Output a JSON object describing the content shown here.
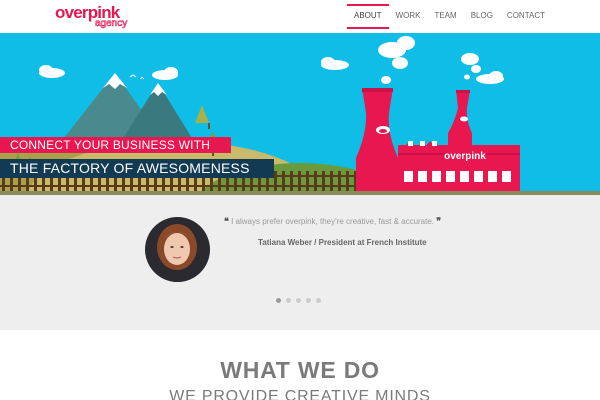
{
  "brand": {
    "name": "overpink",
    "tagline": "agency",
    "color": "#e8174f"
  },
  "nav": {
    "items": [
      "ABOUT",
      "WORK",
      "TEAM",
      "BLOG",
      "CONTACT"
    ],
    "active": "ABOUT"
  },
  "hero": {
    "line1": "CONNECT YOUR BUSINESS WITH",
    "line2": "THE FACTORY OF AWESOMENESS",
    "factory_sign": "overpink",
    "sky_color": "#10bde6",
    "slides": 2,
    "active_slide": 1
  },
  "testimonial": {
    "quote": "I always prefer overpink, they're creative, fast & accurate.",
    "open_quote": "❝",
    "close_quote": "❞",
    "author": "Tatiana Weber / President at French Institute",
    "slides": 5,
    "active_slide": 1
  },
  "what_we_do": {
    "title": "WHAT WE DO",
    "subtitle": "WE PROVIDE CREATIVE MINDS"
  }
}
